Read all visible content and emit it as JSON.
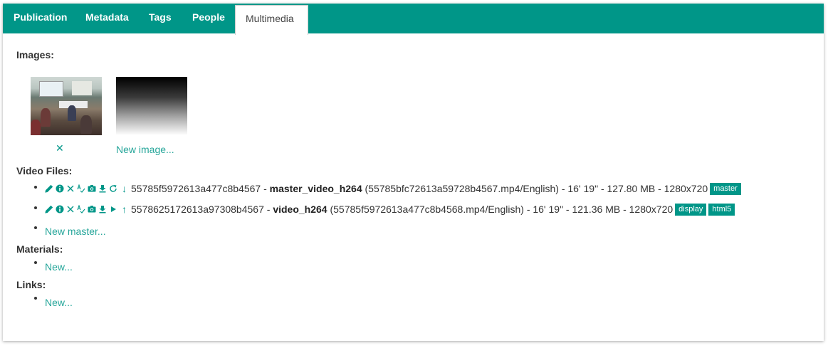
{
  "tabs": [
    {
      "label": "Publication"
    },
    {
      "label": "Metadata"
    },
    {
      "label": "Tags"
    },
    {
      "label": "People"
    },
    {
      "label": "Multimedia"
    }
  ],
  "images": {
    "label": "Images:",
    "remove_symbol": "✕",
    "new_link": "New image..."
  },
  "video_files": {
    "label": "Video Files:",
    "items": [
      {
        "id": "55785f5972613a477c8b4567",
        "sep1": " - ",
        "name": "master_video_h264",
        "details": " (55785bfc72613a59728b4567.mp4/English) - 16' 19\" - 127.80 MB - 1280x720",
        "arrow": "↓",
        "badges": [
          "master"
        ]
      },
      {
        "id": "5578625172613a97308b4567",
        "sep1": " - ",
        "name": "video_h264",
        "details": " (55785f5972613a477c8b4568.mp4/English) - 16' 19\" - 121.36 MB - 1280x720",
        "arrow": "↑",
        "badges": [
          "display",
          "html5"
        ]
      }
    ],
    "new_link": "New master..."
  },
  "materials": {
    "label": "Materials:",
    "new_link": "New..."
  },
  "links": {
    "label": "Links:",
    "new_link": "New..."
  },
  "colors": {
    "accent": "#009688",
    "link": "#26a69a"
  }
}
